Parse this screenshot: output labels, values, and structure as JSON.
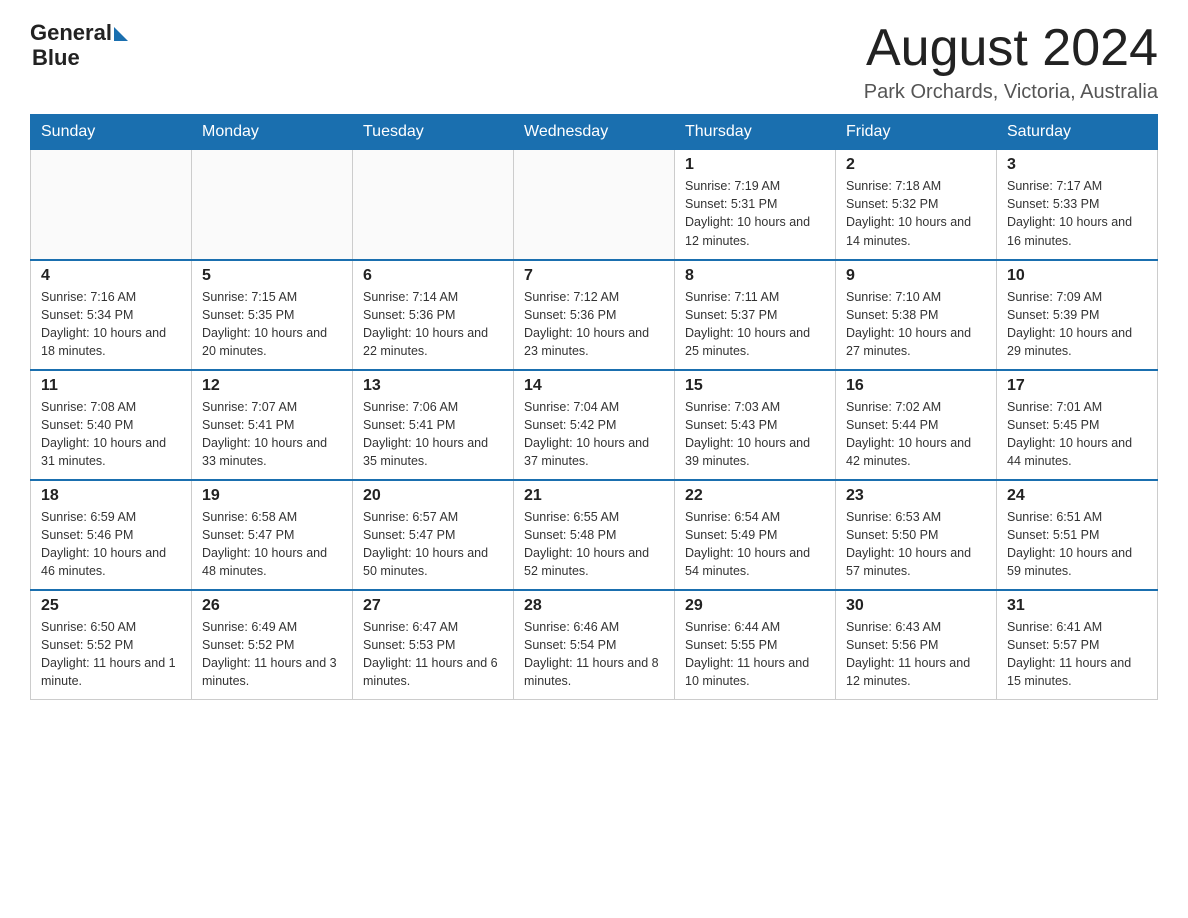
{
  "header": {
    "logo_text_general": "General",
    "logo_text_blue": "Blue",
    "month_title": "August 2024",
    "location": "Park Orchards, Victoria, Australia"
  },
  "days_of_week": [
    "Sunday",
    "Monday",
    "Tuesday",
    "Wednesday",
    "Thursday",
    "Friday",
    "Saturday"
  ],
  "weeks": [
    [
      {
        "day": "",
        "info": ""
      },
      {
        "day": "",
        "info": ""
      },
      {
        "day": "",
        "info": ""
      },
      {
        "day": "",
        "info": ""
      },
      {
        "day": "1",
        "info": "Sunrise: 7:19 AM\nSunset: 5:31 PM\nDaylight: 10 hours and 12 minutes."
      },
      {
        "day": "2",
        "info": "Sunrise: 7:18 AM\nSunset: 5:32 PM\nDaylight: 10 hours and 14 minutes."
      },
      {
        "day": "3",
        "info": "Sunrise: 7:17 AM\nSunset: 5:33 PM\nDaylight: 10 hours and 16 minutes."
      }
    ],
    [
      {
        "day": "4",
        "info": "Sunrise: 7:16 AM\nSunset: 5:34 PM\nDaylight: 10 hours and 18 minutes."
      },
      {
        "day": "5",
        "info": "Sunrise: 7:15 AM\nSunset: 5:35 PM\nDaylight: 10 hours and 20 minutes."
      },
      {
        "day": "6",
        "info": "Sunrise: 7:14 AM\nSunset: 5:36 PM\nDaylight: 10 hours and 22 minutes."
      },
      {
        "day": "7",
        "info": "Sunrise: 7:12 AM\nSunset: 5:36 PM\nDaylight: 10 hours and 23 minutes."
      },
      {
        "day": "8",
        "info": "Sunrise: 7:11 AM\nSunset: 5:37 PM\nDaylight: 10 hours and 25 minutes."
      },
      {
        "day": "9",
        "info": "Sunrise: 7:10 AM\nSunset: 5:38 PM\nDaylight: 10 hours and 27 minutes."
      },
      {
        "day": "10",
        "info": "Sunrise: 7:09 AM\nSunset: 5:39 PM\nDaylight: 10 hours and 29 minutes."
      }
    ],
    [
      {
        "day": "11",
        "info": "Sunrise: 7:08 AM\nSunset: 5:40 PM\nDaylight: 10 hours and 31 minutes."
      },
      {
        "day": "12",
        "info": "Sunrise: 7:07 AM\nSunset: 5:41 PM\nDaylight: 10 hours and 33 minutes."
      },
      {
        "day": "13",
        "info": "Sunrise: 7:06 AM\nSunset: 5:41 PM\nDaylight: 10 hours and 35 minutes."
      },
      {
        "day": "14",
        "info": "Sunrise: 7:04 AM\nSunset: 5:42 PM\nDaylight: 10 hours and 37 minutes."
      },
      {
        "day": "15",
        "info": "Sunrise: 7:03 AM\nSunset: 5:43 PM\nDaylight: 10 hours and 39 minutes."
      },
      {
        "day": "16",
        "info": "Sunrise: 7:02 AM\nSunset: 5:44 PM\nDaylight: 10 hours and 42 minutes."
      },
      {
        "day": "17",
        "info": "Sunrise: 7:01 AM\nSunset: 5:45 PM\nDaylight: 10 hours and 44 minutes."
      }
    ],
    [
      {
        "day": "18",
        "info": "Sunrise: 6:59 AM\nSunset: 5:46 PM\nDaylight: 10 hours and 46 minutes."
      },
      {
        "day": "19",
        "info": "Sunrise: 6:58 AM\nSunset: 5:47 PM\nDaylight: 10 hours and 48 minutes."
      },
      {
        "day": "20",
        "info": "Sunrise: 6:57 AM\nSunset: 5:47 PM\nDaylight: 10 hours and 50 minutes."
      },
      {
        "day": "21",
        "info": "Sunrise: 6:55 AM\nSunset: 5:48 PM\nDaylight: 10 hours and 52 minutes."
      },
      {
        "day": "22",
        "info": "Sunrise: 6:54 AM\nSunset: 5:49 PM\nDaylight: 10 hours and 54 minutes."
      },
      {
        "day": "23",
        "info": "Sunrise: 6:53 AM\nSunset: 5:50 PM\nDaylight: 10 hours and 57 minutes."
      },
      {
        "day": "24",
        "info": "Sunrise: 6:51 AM\nSunset: 5:51 PM\nDaylight: 10 hours and 59 minutes."
      }
    ],
    [
      {
        "day": "25",
        "info": "Sunrise: 6:50 AM\nSunset: 5:52 PM\nDaylight: 11 hours and 1 minute."
      },
      {
        "day": "26",
        "info": "Sunrise: 6:49 AM\nSunset: 5:52 PM\nDaylight: 11 hours and 3 minutes."
      },
      {
        "day": "27",
        "info": "Sunrise: 6:47 AM\nSunset: 5:53 PM\nDaylight: 11 hours and 6 minutes."
      },
      {
        "day": "28",
        "info": "Sunrise: 6:46 AM\nSunset: 5:54 PM\nDaylight: 11 hours and 8 minutes."
      },
      {
        "day": "29",
        "info": "Sunrise: 6:44 AM\nSunset: 5:55 PM\nDaylight: 11 hours and 10 minutes."
      },
      {
        "day": "30",
        "info": "Sunrise: 6:43 AM\nSunset: 5:56 PM\nDaylight: 11 hours and 12 minutes."
      },
      {
        "day": "31",
        "info": "Sunrise: 6:41 AM\nSunset: 5:57 PM\nDaylight: 11 hours and 15 minutes."
      }
    ]
  ]
}
